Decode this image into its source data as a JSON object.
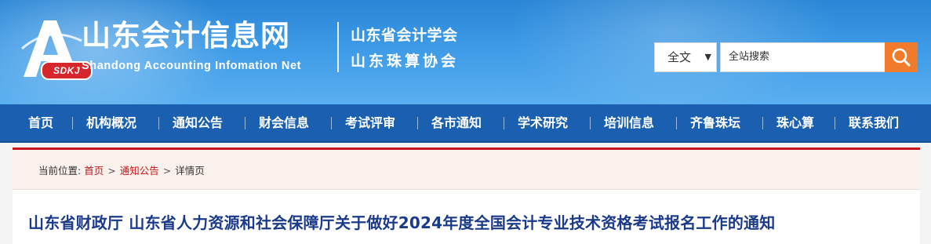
{
  "header": {
    "logo_badge": "SDKJ",
    "site_title": "山东会计信息网",
    "site_subtitle": "Shandong Accounting Infomation Net",
    "associations": [
      "山东省会计学会",
      "山东珠算协会"
    ]
  },
  "search": {
    "scope_selected": "全文",
    "placeholder": "全站搜索",
    "button_icon": "search-icon"
  },
  "nav": {
    "items": [
      "首页",
      "机构概况",
      "通知公告",
      "财会信息",
      "考试评审",
      "各市通知",
      "学术研究",
      "培训信息",
      "齐鲁珠坛",
      "珠心算",
      "联系我们"
    ]
  },
  "breadcrumb": {
    "prefix": "当前位置:",
    "items": [
      "首页",
      "通知公告",
      "详情页"
    ]
  },
  "article": {
    "title": "山东省财政厅 山东省人力资源和社会保障厅关于做好2024年度全国会计专业技术资格考试报名工作的通知"
  },
  "colors": {
    "header_blue": "#2a86d6",
    "nav_blue": "#1a5fb0",
    "accent_red": "#c4161c",
    "search_button": "#f07b2a",
    "title_blue": "#1b3a8a"
  }
}
